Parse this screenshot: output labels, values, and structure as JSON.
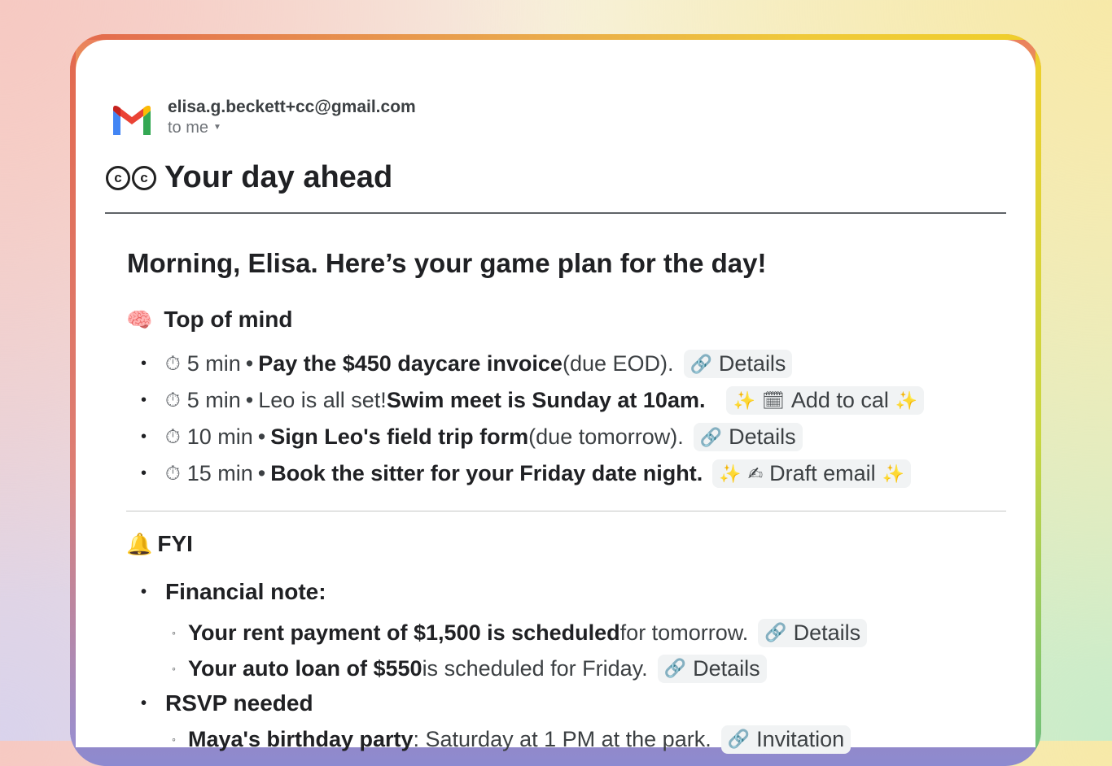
{
  "email": {
    "sender": "elisa.g.beckett+cc@gmail.com",
    "recipient": "to me",
    "title_icon": "cc",
    "title": "Your day ahead",
    "greeting": "Morning, Elisa. Here’s your game plan for the day!"
  },
  "top_of_mind": {
    "icon": "brain-icon",
    "heading": "Top of mind",
    "items": [
      {
        "time": "5 min",
        "pre": "",
        "bold": "Pay the $450 daycare invoice",
        "post": " (due EOD).",
        "chip": "Details",
        "chip_type": "link"
      },
      {
        "time": "5 min",
        "pre": "Leo is all set! ",
        "bold": "Swim meet is Sunday at 10am.",
        "post": "",
        "chip": "Add to cal",
        "chip_type": "sparkle-calendar"
      },
      {
        "time": "10 min",
        "pre": "",
        "bold": "Sign Leo's field trip form",
        "post": " (due tomorrow).",
        "chip": "Details",
        "chip_type": "link"
      },
      {
        "time": "15 min",
        "pre": "",
        "bold": "Book the sitter for your Friday date night.",
        "post": "",
        "chip": "Draft email",
        "chip_type": "sparkle-writing"
      }
    ]
  },
  "fyi": {
    "icon": "bell-icon",
    "heading": "FYI",
    "financial_heading": "Financial note:",
    "financial_items": [
      {
        "bold": "Your rent payment of $1,500 is scheduled",
        "post": " for tomorrow.",
        "chip": "Details"
      },
      {
        "bold": "Your auto loan of $550",
        "post": " is scheduled for Friday.",
        "chip": "Details"
      }
    ],
    "rsvp_heading": "RSVP needed",
    "rsvp_items": [
      {
        "bold": "Maya's birthday party",
        "post": ": Saturday at 1 PM at the park.",
        "chip": "Invitation"
      }
    ]
  },
  "separator": "•"
}
